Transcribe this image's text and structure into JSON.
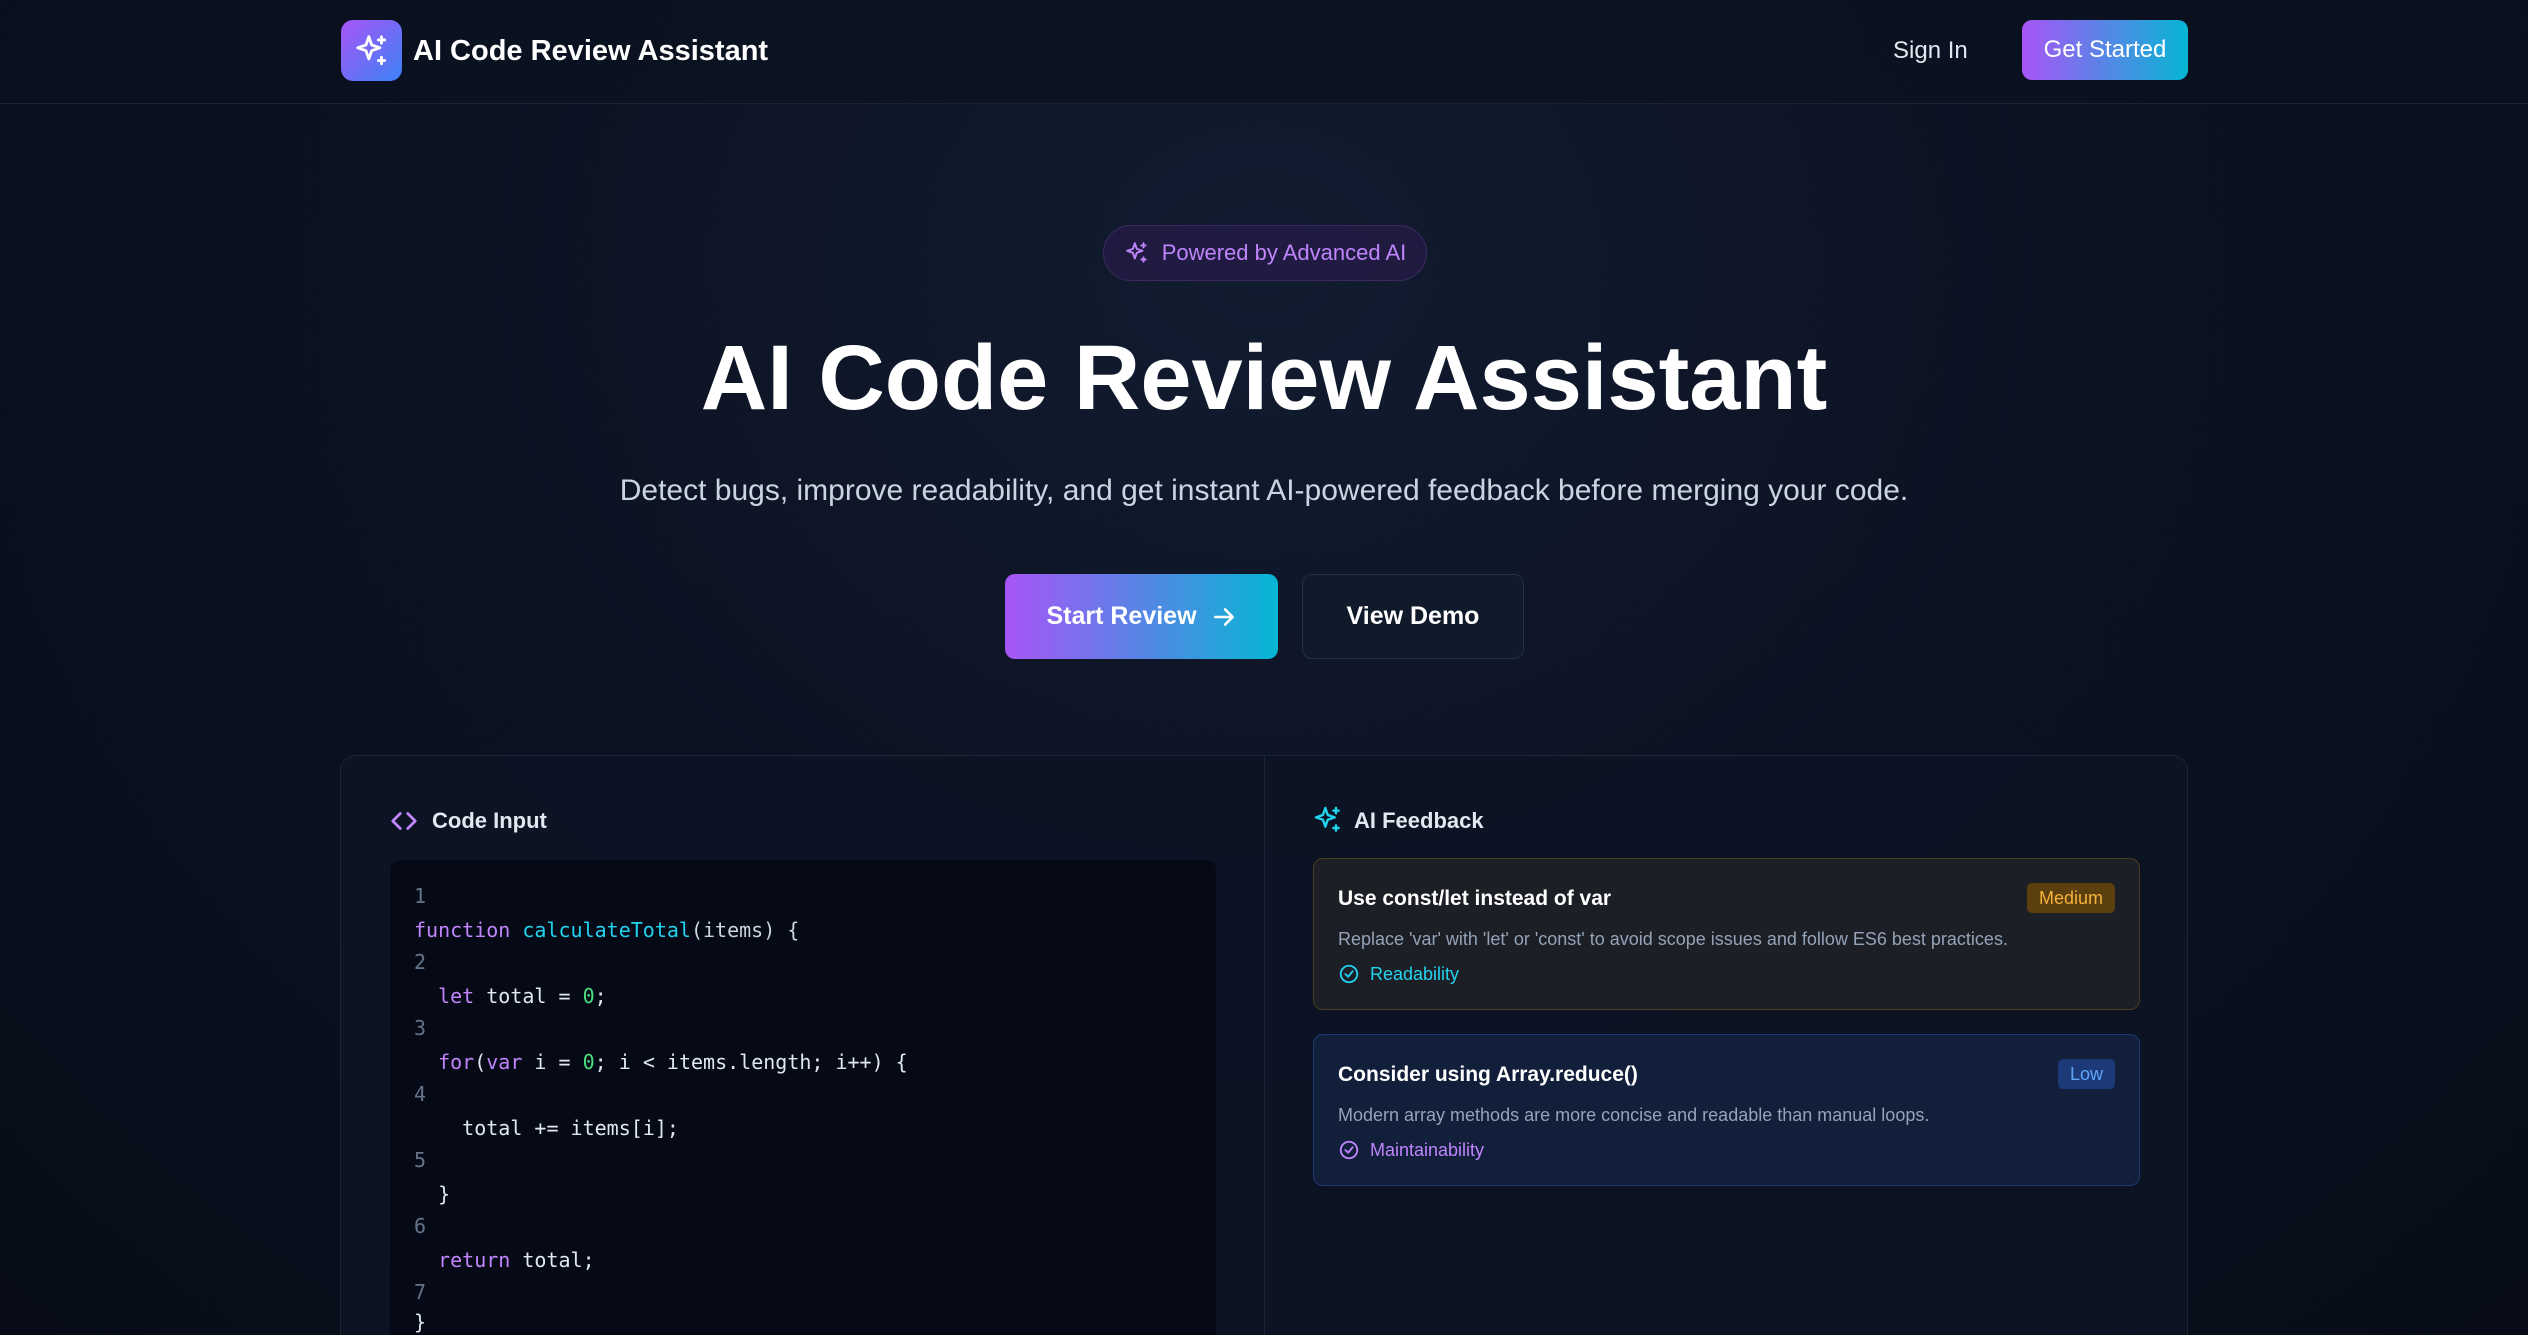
{
  "nav": {
    "brand": "AI Code Review Assistant",
    "sign_in": "Sign In",
    "get_started": "Get Started",
    "logo_icon": "sparkles-icon"
  },
  "hero": {
    "pill_text": "Powered by Advanced AI",
    "title": "AI Code Review Assistant",
    "subtitle": "Detect bugs, improve readability, and get instant AI-powered feedback before merging your code.",
    "start_review": "Start Review",
    "view_demo": "View Demo"
  },
  "code_input": {
    "title": "Code Input",
    "line_numbers": [
      "1",
      "2",
      "3",
      "4",
      "5",
      "6",
      "7"
    ],
    "lines": [
      "function calculateTotal(items) {",
      "  let total = 0;",
      "  for(var i = 0; i < items.length; i++) {",
      "    total += items[i];",
      "  }",
      "  return total;",
      "}"
    ]
  },
  "ai_feedback": {
    "title": "AI Feedback",
    "cards": [
      {
        "title": "Use const/let instead of var",
        "severity": "Medium",
        "description": "Replace 'var' with 'let' or 'const' to avoid scope issues and follow ES6 best practices.",
        "category": "Readability"
      },
      {
        "title": "Consider using Array.reduce()",
        "severity": "Low",
        "description": "Modern array methods are more concise and readable than manual loops.",
        "category": "Maintainability"
      }
    ]
  },
  "colors": {
    "accent_purple": "#a855f7",
    "accent_cyan": "#06b6d4",
    "medium": "#f5b13c",
    "low": "#60a5fa"
  }
}
